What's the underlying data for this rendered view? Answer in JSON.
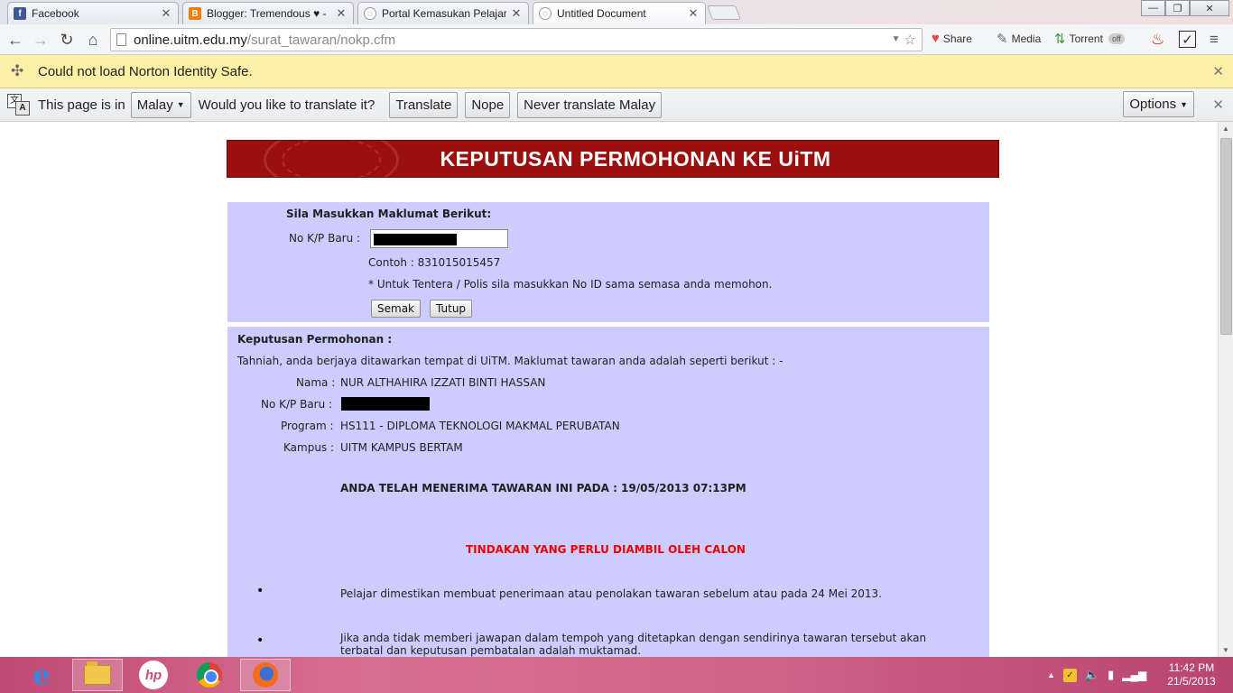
{
  "tabs": [
    {
      "title": "Facebook",
      "favicon": "facebook-favicon",
      "color": "#3b5998"
    },
    {
      "title": "Blogger: Tremendous ♥ -",
      "favicon": "blogger-favicon",
      "color": "#f57d00"
    },
    {
      "title": "Portal Kemasukan Pelajar",
      "favicon": "uitm-favicon",
      "color": "#888888"
    },
    {
      "title": "Untitled Document",
      "favicon": "uitm-favicon",
      "color": "#888888"
    }
  ],
  "toolbar": {
    "url_host": "online.uitm.edu.my",
    "url_path": "/surat_tawaran/nokp.cfm",
    "extensions": [
      {
        "label": "Share",
        "icon": "heart-icon"
      },
      {
        "label": "Media",
        "icon": "media-icon"
      },
      {
        "label": "Torrent",
        "icon": "torrent-icon"
      }
    ]
  },
  "norton_bar": {
    "message": "Could not load Norton Identity Safe."
  },
  "translate_bar": {
    "prefix": "This page is in",
    "language": "Malay",
    "question": "Would you like to translate it?",
    "translate_label": "Translate",
    "nope_label": "Nope",
    "never_label": "Never translate Malay",
    "options_label": "Options"
  },
  "page": {
    "banner_title": "KEPUTUSAN PERMOHONAN KE UiTM",
    "form": {
      "heading": "Sila Masukkan Maklumat Berikut:",
      "kp_label": "No K/P Baru :",
      "example": "Contoh : 831015015457",
      "note": "* Untuk Tentera / Polis sila masukkan No ID sama semasa anda memohon.",
      "check_button": "Semak",
      "close_button": "Tutup"
    },
    "result": {
      "heading": "Keputusan Permohonan :",
      "congrats": "Tahniah, anda berjaya ditawarkan tempat di UiTM. Maklumat tawaran anda adalah seperti berikut : -",
      "name_label": "Nama :",
      "name_value": "NUR ALTHAHIRA IZZATI BINTI HASSAN",
      "kp_label": "No K/P Baru :",
      "program_label": "Program :",
      "program_value": "HS111 - DIPLOMA TEKNOLOGI MAKMAL PERUBATAN",
      "campus_label": "Kampus :",
      "campus_value": "UITM KAMPUS BERTAM",
      "accepted": "ANDA TELAH MENERIMA TAWARAN INI PADA : 19/05/2013 07:13PM",
      "action_heading": "TINDAKAN YANG PERLU DIAMBIL OLEH CALON",
      "bullet1": "Pelajar dimestikan membuat penerimaan atau penolakan tawaran sebelum atau pada 24 Mei 2013.",
      "bullet2": "Jika anda tidak memberi jawapan dalam tempoh yang ditetapkan dengan sendirinya tawaran tersebut akan terbatal dan keputusan pembatalan adalah muktamad."
    }
  },
  "taskbar": {
    "time": "11:42 PM",
    "date": "21/5/2013"
  },
  "colors": {
    "banner": "#9c0f0f",
    "panel": "#ccccff",
    "action_red": "#ee0000",
    "infobar_yellow": "#fbf0a6"
  }
}
